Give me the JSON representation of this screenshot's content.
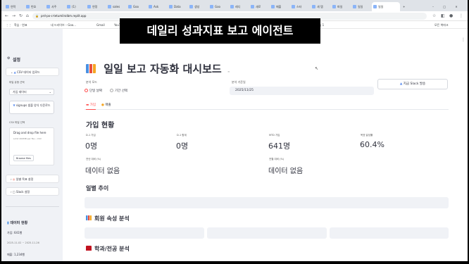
{
  "browser": {
    "tabs": [
      {
        "label": "연락"
      },
      {
        "label": "번호"
      },
      {
        "label": "사주"
      },
      {
        "label": "(1)"
      },
      {
        "label": "연정"
      },
      {
        "label": "sales"
      },
      {
        "label": "Goo"
      },
      {
        "label": "Ask"
      },
      {
        "label": "Data"
      },
      {
        "label": "생성"
      },
      {
        "label": "Goo"
      },
      {
        "label": "레디"
      },
      {
        "label": "새로"
      },
      {
        "label": "매출"
      },
      {
        "label": "스타"
      },
      {
        "label": "새 탭"
      },
      {
        "label": "파일"
      },
      {
        "label": "일일"
      },
      {
        "label": "일일"
      }
    ],
    "url": "prd-po-c-tetumilrolbm.replit.app",
    "bookmarks": [
      "학습 · 연표",
      "내 드라이브 – Goo...",
      "Gmail",
      "YouTube",
      "지도",
      "Dashboard: Sample...",
      "비밀 – 연표",
      "학생 엑 – 연표...",
      "Untitled.. 연표연습 1",
      "모든 북마크"
    ]
  },
  "caption": "데일리 성과지표 보고 에이전트",
  "sidebar": {
    "title": "설정",
    "csv_expander": "CSV 데이터 업로드",
    "file_type_label": "파일 유형 선택",
    "file_type_value": "가입 데이터",
    "sample_button": "signups 샘플 양식 다운로드",
    "upload_label": "CSV 파일 선택",
    "dropzone_title": "Drag and drop file here",
    "dropzone_limit": "Limit 200MB per file • CSV",
    "browse_button": "Browse files",
    "daily_goal_expander": "일별 목표 설정",
    "slack_expander": "Slack 설정",
    "data_section_title": "데이터 현황",
    "signup_count": "가입: 641행",
    "signup_range": "2025-11-02 ~ 2025-11-26",
    "sales_count": "매출: 1,234행"
  },
  "main": {
    "title": "일일 보고 자동화 대시보드",
    "analysis_mode_label": "분석 모드",
    "mode_options": [
      "단일 날짜",
      "기간 선택"
    ],
    "selected_mode": "단일 날짜",
    "base_date_label": "분석 기준일",
    "base_date_value": "2025/11/25",
    "slack_button": "지금 Slack 발송",
    "tabs": [
      "가입",
      "매출"
    ],
    "active_tab": "가입",
    "signup_status_title": "가입 현황",
    "metrics": [
      {
        "label": "D-1 가입",
        "value": "0명"
      },
      {
        "label": "D-1 합계",
        "value": "0명"
      },
      {
        "label": "MTD 가입",
        "value": "641명"
      },
      {
        "label": "목표 달성률",
        "value": "60.4%"
      }
    ],
    "compare_metrics": [
      {
        "label": "전년 대비 (%)",
        "value": "데이터 없음"
      },
      {
        "label": "전월 대비 (%)",
        "value": "데이터 없음"
      }
    ],
    "daily_trend_title": "일별 추이",
    "member_attr_title": "회원 속성 분석",
    "dept_title": "학과/전공 분석"
  }
}
